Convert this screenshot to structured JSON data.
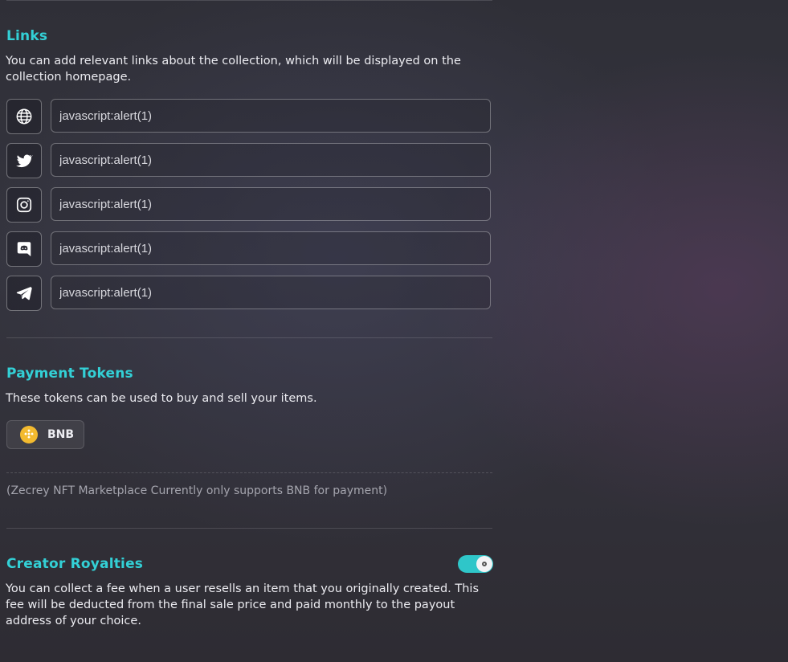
{
  "links": {
    "title": "Links",
    "description": "You can add relevant links about the collection, which will be displayed on the collection homepage.",
    "items": [
      {
        "icon": "globe-icon",
        "value": "javascript:alert(1)"
      },
      {
        "icon": "twitter-icon",
        "value": "javascript:alert(1)"
      },
      {
        "icon": "instagram-icon",
        "value": "javascript:alert(1)"
      },
      {
        "icon": "discord-icon",
        "value": "javascript:alert(1)"
      },
      {
        "icon": "telegram-icon",
        "value": "javascript:alert(1)"
      }
    ]
  },
  "payment": {
    "title": "Payment Tokens",
    "description": "These tokens can be used to buy and sell your items.",
    "token": {
      "label": "BNB",
      "icon": "bnb-icon"
    },
    "note": "(Zecrey NFT Marketplace Currently only supports BNB for payment)"
  },
  "royalties": {
    "title": "Creator Royalties",
    "description": "You can collect a fee when a user resells an item that you originally created. This fee will be deducted from the final sale price and paid monthly to the payout address of your choice.",
    "enabled": true
  },
  "colors": {
    "accent": "#33d0d6",
    "toggle": "#2fc6c9",
    "bnb": "#f3ba2f"
  }
}
